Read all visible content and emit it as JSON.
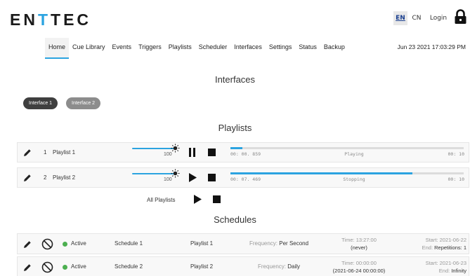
{
  "brand": {
    "logo_parts": [
      "EN",
      "T",
      "TEC"
    ]
  },
  "header": {
    "lang_en": "EN",
    "lang_cn": "CN",
    "login": "Login",
    "lock_icon": "lock-icon"
  },
  "nav": {
    "items": [
      "Home",
      "Cue Library",
      "Events",
      "Triggers",
      "Playlists",
      "Scheduler",
      "Interfaces",
      "Settings",
      "Status",
      "Backup"
    ],
    "active": "Home",
    "datetime": "Jun 23 2021 17:03:29 PM"
  },
  "interfaces": {
    "title": "Interfaces",
    "items": [
      "Interface 1",
      "Interface 2"
    ]
  },
  "playlists": {
    "title": "Playlists",
    "rows": [
      {
        "index": "1",
        "name": "Playlist 1",
        "volume": "100",
        "time": "00: 00. 859",
        "state": "Playing",
        "duration": "00: 10",
        "progress": 0.05,
        "controls": [
          "pause-icon",
          "stop-icon"
        ]
      },
      {
        "index": "2",
        "name": "Playlist 2",
        "volume": "100",
        "time": "00: 07. 469",
        "state": "Stopping",
        "duration": "00: 10",
        "progress": 0.78,
        "controls": [
          "play-icon",
          "stop-icon"
        ]
      }
    ],
    "all_label": "All Playlists"
  },
  "schedules": {
    "title": "Schedules",
    "rows": [
      {
        "status": "Active",
        "name": "Schedule 1",
        "playlist": "Playlist 1",
        "freq_label": "Frequency:",
        "freq_value": "Per Second",
        "time_label": "Time:",
        "time_value": "13:27:00",
        "time_extra": "(never)",
        "start_label": "Start:",
        "start_value": "2021-06-22",
        "end_label": "End:",
        "end_value": "Repetitions: 1"
      },
      {
        "status": "Active",
        "name": "Schedule 2",
        "playlist": "Playlist 2",
        "freq_label": "Frequency:",
        "freq_value": "Daily",
        "time_label": "Time:",
        "time_value": "00:00:00",
        "time_extra": "(2021-06-24 00:00:00)",
        "start_label": "Start:",
        "start_value": "2021-06-23",
        "end_label": "End:",
        "end_value": "Infinity"
      }
    ]
  },
  "colors": {
    "accent": "#2ba3e0",
    "active_dot": "#4caf50",
    "pill_dark": "#3f3f3f",
    "pill_light": "#8c8c8c"
  }
}
